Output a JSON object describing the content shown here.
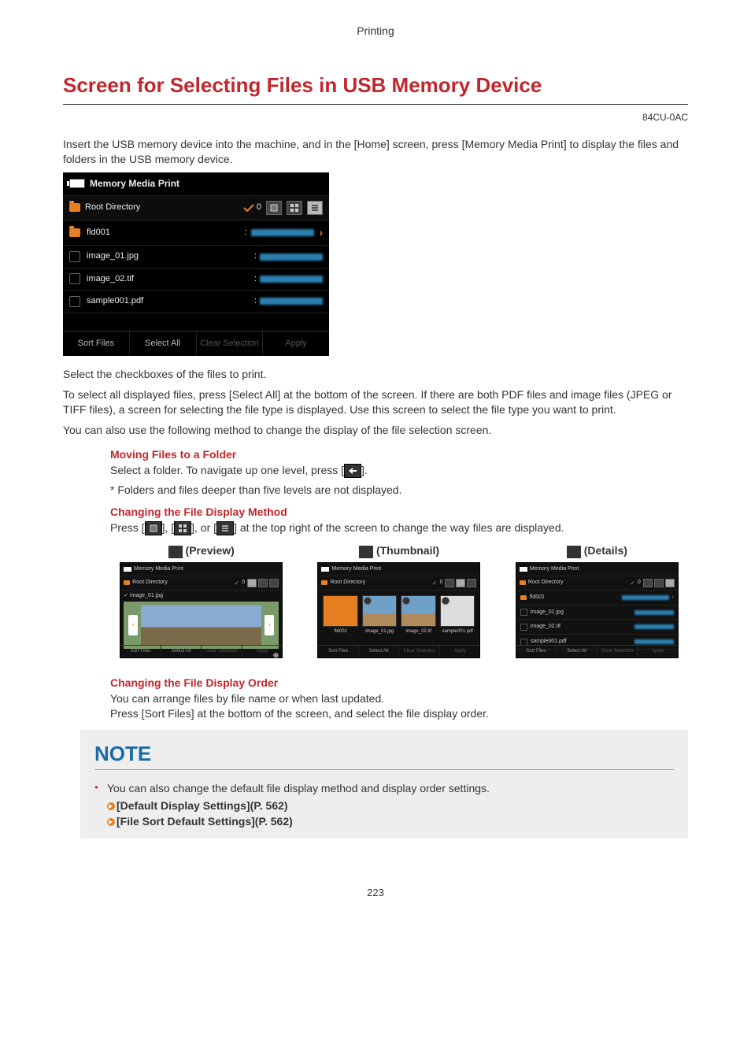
{
  "header": {
    "section": "Printing"
  },
  "title": "Screen for Selecting Files in USB Memory Device",
  "docid": "84CU-0AC",
  "intro": "Insert the USB memory device into the machine, and in the [Home] screen, press [Memory Media Print] to display the files and folders in the USB memory device.",
  "screen": {
    "title": "Memory Media Print",
    "root": "Root Directory",
    "check_count": "0",
    "rows": [
      {
        "type": "folder",
        "name": "fld001"
      },
      {
        "type": "file",
        "name": "image_01.jpg"
      },
      {
        "type": "file",
        "name": "image_02.tif"
      },
      {
        "type": "file",
        "name": "sample001.pdf"
      }
    ],
    "footer": {
      "sort": "Sort Files",
      "select_all": "Select All",
      "clear": "Clear Selection",
      "apply": "Apply"
    }
  },
  "after_screen": {
    "p1": "Select the checkboxes of the files to print.",
    "p2": "To select all displayed files, press [Select All] at the bottom of the screen. If there are both PDF files and image files (JPEG or TIFF files), a screen for selecting the file type is displayed. Use this screen to select the file type you want to print.",
    "p3": "You can also use the following method to change the display of the file selection screen."
  },
  "moving": {
    "heading": "Moving Files to a Folder",
    "line1a": "Select a folder. To navigate up one level, press [",
    "line1b": "].",
    "line2": "* Folders and files deeper than five levels are not displayed."
  },
  "display_method": {
    "heading": "Changing the File Display Method",
    "line_a": "Press [",
    "line_sep": "], [",
    "line_or": "], or [",
    "line_b": "] at the top right of the screen to change the way files are displayed."
  },
  "views": {
    "preview": {
      "label": "(Preview)",
      "file": "image_01.jpg"
    },
    "thumbnail": {
      "label": "(Thumbnail)",
      "items": [
        "fld001",
        "image_01.jpg",
        "image_02.tif",
        "sample001.pdf"
      ]
    },
    "details": {
      "label": "(Details)"
    },
    "common": {
      "title": "Memory Media Print",
      "root": "Root Directory",
      "check": "0",
      "sort": "Sort Files",
      "select_all": "Select All",
      "clear": "Clear Selection",
      "apply": "Apply"
    }
  },
  "display_order": {
    "heading": "Changing the File Display Order",
    "p1": "You can arrange files by file name or when last updated.",
    "p2": "Press [Sort Files] at the bottom of the screen, and select the file display order."
  },
  "note": {
    "title": "NOTE",
    "line": "You can also change the default file display method and display order settings.",
    "link1": "[Default Display Settings](P. 562)",
    "link2": "[File Sort Default Settings](P. 562)"
  },
  "page_number": "223"
}
